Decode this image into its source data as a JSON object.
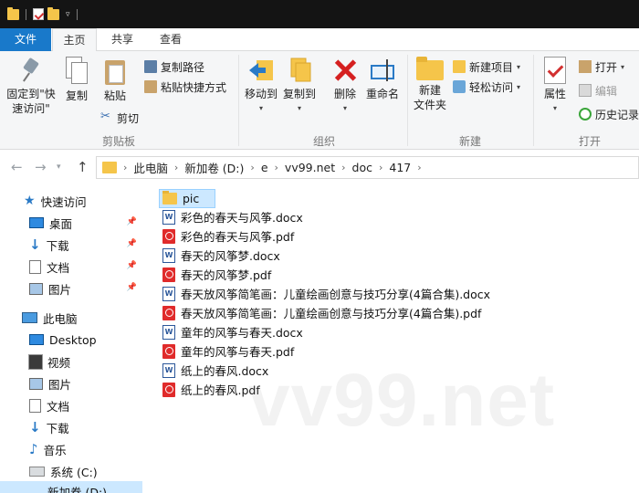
{
  "ribbon_tabs": {
    "file": "文件",
    "home": "主页",
    "share": "共享",
    "view": "查看"
  },
  "clipboard": {
    "pin_quick": "固定到\"快",
    "pin_quick2": "速访问\"",
    "copy": "复制",
    "paste": "粘贴",
    "copy_path": "复制路径",
    "paste_shortcut": "粘贴快捷方式",
    "cut": "剪切",
    "group": "剪贴板"
  },
  "organize": {
    "move_to": "移动到",
    "copy_to": "复制到",
    "delete": "删除",
    "rename": "重命名",
    "group": "组织"
  },
  "new": {
    "new_folder": "新建",
    "new_folder2": "文件夹",
    "new_item": "新建项目",
    "easy_access": "轻松访问",
    "group": "新建"
  },
  "open": {
    "properties": "属性",
    "open": "打开",
    "edit": "编辑",
    "history": "历史记录",
    "group": "打开"
  },
  "address": {
    "crumbs": [
      "此电脑",
      "新加卷 (D:)",
      "e",
      "vv99.net",
      "doc",
      "417"
    ]
  },
  "nav": {
    "quick_access": "快速访问",
    "quick_items": [
      "桌面",
      "下载",
      "文档",
      "图片"
    ],
    "this_pc": "此电脑",
    "pc_items": [
      "Desktop",
      "视频",
      "图片",
      "文档",
      "下载",
      "音乐",
      "系统 (C:)",
      "新加卷 (D:)"
    ]
  },
  "files": [
    {
      "name": "pic",
      "type": "folder"
    },
    {
      "name": "彩色的春天与风筝.docx",
      "type": "docx"
    },
    {
      "name": "彩色的春天与风筝.pdf",
      "type": "pdf"
    },
    {
      "name": "春天的风筝梦.docx",
      "type": "docx"
    },
    {
      "name": "春天的风筝梦.pdf",
      "type": "pdf"
    },
    {
      "name": "春天放风筝简笔画：儿童绘画创意与技巧分享(4篇合集).docx",
      "type": "docx"
    },
    {
      "name": "春天放风筝简笔画：儿童绘画创意与技巧分享(4篇合集).pdf",
      "type": "pdf"
    },
    {
      "name": "童年的风筝与春天.docx",
      "type": "docx"
    },
    {
      "name": "童年的风筝与春天.pdf",
      "type": "pdf"
    },
    {
      "name": "纸上的春风.docx",
      "type": "docx"
    },
    {
      "name": "纸上的春风.pdf",
      "type": "pdf"
    }
  ],
  "watermark": "vv99.net"
}
